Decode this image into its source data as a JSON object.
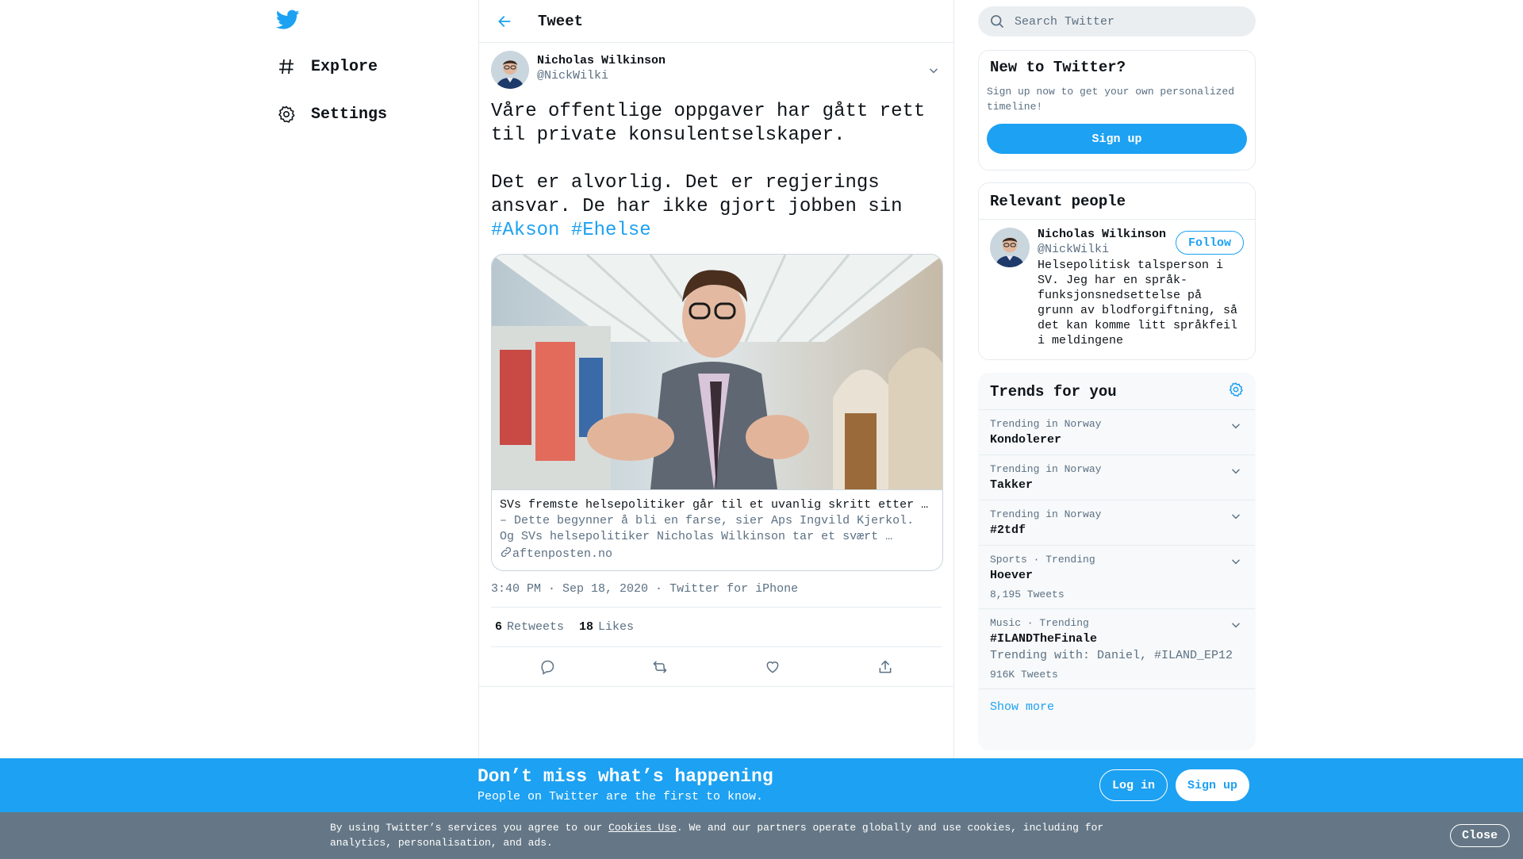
{
  "nav": {
    "logo": "twitter-bird-icon",
    "items": [
      {
        "label": "Explore",
        "icon": "hashtag-icon"
      },
      {
        "label": "Settings",
        "icon": "gear-icon"
      }
    ]
  },
  "header": {
    "title": "Tweet",
    "back_icon": "arrow-left-icon"
  },
  "tweet": {
    "author_name": "Nicholas Wilkinson",
    "author_handle": "@NickWilki",
    "text_line1": "Våre offentlige oppgaver har gått rett til private konsulentselskaper.",
    "text_line2": "Det er alvorlig. Det er regjerings ansvar. De har ikke gjort jobben sin",
    "hashtag1": "#Akson",
    "hashtag2": "#Ehelse",
    "card": {
      "title": "SVs fremste helsepolitiker går til et uvanlig skritt etter …",
      "description": "– Dette begynner å bli en farse, sier Aps Ingvild Kjerkol. Og SVs helsepolitiker Nicholas Wilkinson tar et svært …",
      "domain": "aftenposten.no"
    },
    "time": "3:40 PM · Sep 18, 2020",
    "source": "Twitter for iPhone",
    "retweets": "6",
    "retweets_label": "Retweets",
    "likes": "18",
    "likes_label": "Likes"
  },
  "search": {
    "placeholder": "Search Twitter"
  },
  "new_to_twitter": {
    "title": "New to Twitter?",
    "subtitle": "Sign up now to get your own personalized timeline!",
    "button": "Sign up"
  },
  "relevant": {
    "title": "Relevant people",
    "name": "Nicholas Wilkinson",
    "handle": "@NickWilki",
    "bio": "Helsepolitisk talsperson i SV. Jeg har en språk-funksjonsnedsettelse på grunn av blodforgiftning, så det kan komme litt språkfeil i meldingene",
    "follow": "Follow"
  },
  "trends": {
    "title": "Trends for you",
    "items": [
      {
        "context": "Trending in Norway",
        "name": "Kondolerer"
      },
      {
        "context": "Trending in Norway",
        "name": "Takker"
      },
      {
        "context": "Trending in Norway",
        "name": "#2tdf"
      },
      {
        "context": "Sports · Trending",
        "name": "Hoever",
        "count": "8,195 Tweets"
      },
      {
        "context": "Music · Trending",
        "name": "#ILANDTheFinale",
        "with": "Trending with: Daniel, #ILAND_EP12",
        "count": "916K Tweets"
      }
    ],
    "show_more": "Show more"
  },
  "banner": {
    "title": "Don’t miss what’s happening",
    "subtitle": "People on Twitter are the first to know.",
    "login": "Log in",
    "signup": "Sign up"
  },
  "cookie": {
    "prefix": "By using Twitter’s services you agree to our ",
    "link": "Cookies Use",
    "suffix": ". We and our partners operate globally and use cookies, including for analytics, personalisation, and ads.",
    "close": "Close"
  },
  "colors": {
    "accent": "#1da1f2",
    "cookie_bg": "#657786"
  }
}
